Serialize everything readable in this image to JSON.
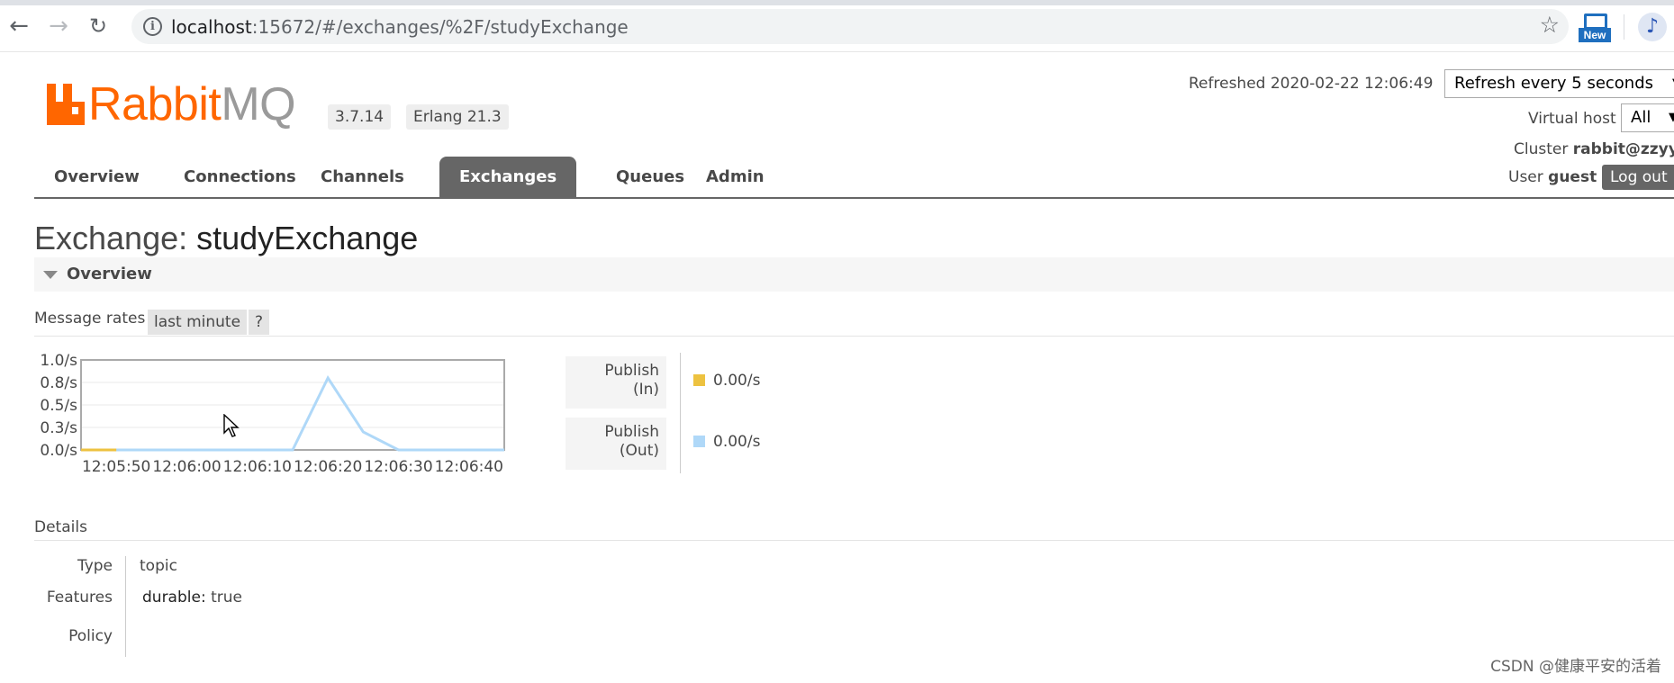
{
  "browser": {
    "url_host": "localhost",
    "url_rest": ":15672/#/exchanges/%2F/studyExchange",
    "extension_label": "New",
    "avatar_glyph": "♪"
  },
  "header": {
    "logo_rabbit": "Rabbit",
    "logo_mq": "MQ",
    "version": "3.7.14",
    "erlang": "Erlang 21.3",
    "refreshed_label": "Refreshed 2020-02-22 12:06:49",
    "refresh_select": "Refresh every 5 seconds",
    "vhost_label": "Virtual host",
    "vhost_select": "All",
    "cluster_label": "Cluster",
    "cluster_value": "rabbit@zzyy",
    "user_label": "User",
    "user_value": "guest",
    "logout": "Log out"
  },
  "tabs": [
    "Overview",
    "Connections",
    "Channels",
    "Exchanges",
    "Queues",
    "Admin"
  ],
  "page": {
    "title_prefix": "Exchange:",
    "title_name": "studyExchange",
    "overview_section": "Overview",
    "message_rates_label": "Message rates",
    "range_pill": "last minute",
    "help_pill": "?",
    "details_label": "Details"
  },
  "publish": [
    {
      "label_line1": "Publish",
      "label_line2": "(In)",
      "rate": "0.00/s",
      "color": "#edc240"
    },
    {
      "label_line1": "Publish",
      "label_line2": "(Out)",
      "rate": "0.00/s",
      "color": "#afd8f8"
    }
  ],
  "details": {
    "type_key": "Type",
    "type_value": "topic",
    "features_key": "Features",
    "features_name": "durable:",
    "features_value": "true",
    "policy_key": "Policy"
  },
  "watermark": "CSDN @健康平安的活着",
  "colors": {
    "accent": "#ff6600",
    "tab_active": "#666666"
  },
  "chart_data": {
    "type": "line",
    "x": [
      "12:05:45",
      "12:05:50",
      "12:06:00",
      "12:06:10",
      "12:06:15",
      "12:06:20",
      "12:06:25",
      "12:06:30",
      "12:06:40",
      "12:06:45"
    ],
    "xticks": [
      "12:05:50",
      "12:06:00",
      "12:06:10",
      "12:06:20",
      "12:06:30",
      "12:06:40"
    ],
    "yticks": [
      "0.0/s",
      "0.3/s",
      "0.5/s",
      "0.8/s",
      "1.0/s"
    ],
    "ylim": [
      0,
      1.0
    ],
    "series": [
      {
        "name": "Publish (In)",
        "color": "#edc240",
        "points": [
          [
            0,
            0
          ],
          [
            5,
            0
          ]
        ]
      },
      {
        "name": "Publish (Out)",
        "color": "#afd8f8",
        "points": [
          [
            0,
            0
          ],
          [
            30,
            0
          ],
          [
            35,
            0.8
          ],
          [
            40,
            0.2
          ],
          [
            45,
            0
          ],
          [
            60,
            0
          ]
        ]
      }
    ]
  }
}
